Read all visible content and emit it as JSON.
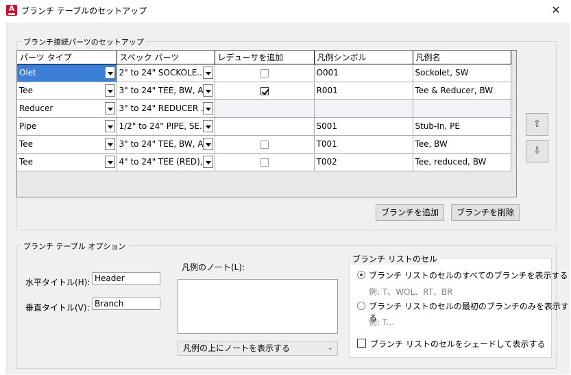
{
  "window": {
    "title": "ブランチ テーブルのセットアップ",
    "close_glyph": "✕",
    "icon_letter": "A"
  },
  "parts_group": {
    "legend": "ブランチ接続パーツのセットアップ",
    "columns": [
      "パーツ タイプ",
      "スペック パーツ",
      "レデューサを追加",
      "凡例シンボル",
      "凡例名"
    ],
    "rows": [
      {
        "part_type": "Olet",
        "spec_part": "2\" to 24\"  SOCKOLE...",
        "add_reducer": "unchecked",
        "symbol": "O001",
        "legend_name": "Sockolet, SW",
        "selected": true
      },
      {
        "part_type": "Tee",
        "spec_part": "3\" to 24\"  TEE, BW, A...",
        "add_reducer": "checked",
        "symbol": "R001",
        "legend_name": "Tee & Reducer, BW"
      },
      {
        "part_type": "Reducer",
        "spec_part": "3\" to 24\"  REDUCER ...",
        "add_reducer": "none",
        "symbol": "",
        "legend_name": "",
        "greyed": true
      },
      {
        "part_type": "Pipe",
        "spec_part": "1/2\" to 24\"  PIPE, SE...",
        "add_reducer": "none",
        "symbol": "S001",
        "legend_name": "Stub-In, PE"
      },
      {
        "part_type": "Tee",
        "spec_part": "3\" to 24\"  TEE, BW, A...",
        "add_reducer": "unchecked",
        "symbol": "T001",
        "legend_name": "Tee, BW"
      },
      {
        "part_type": "Tee",
        "spec_part": "4\" to 24\"  TEE (RED),...",
        "add_reducer": "unchecked",
        "symbol": "T002",
        "legend_name": "Tee, reduced, BW"
      }
    ],
    "move_up_glyph": "⇧",
    "move_down_glyph": "⇩",
    "add_branch_label": "ブランチを追加",
    "delete_branch_label": "ブランチを削除"
  },
  "options_group": {
    "legend": "ブランチ テーブル オプション",
    "horizontal_title_label": "水平タイトル(H):",
    "horizontal_title_value": "Header",
    "vertical_title_label": "垂直タイトル(V):",
    "vertical_title_value": "Branch",
    "legend_note_label": "凡例のノート(L):",
    "legend_note_value": "",
    "note_position_value": "凡例の上にノートを表示する",
    "branch_list_cell": {
      "legend": "ブランチ リストのセル",
      "option_all": "ブランチ リストのセルのすべてのブランチを表示する",
      "option_all_example": "例: T、WOL、RT、BR",
      "option_first": "ブランチ リストのセルの最初のブランチのみを表示する",
      "option_first_example": "例: T...",
      "shade_label": "ブランチ リストのセルをシェードして表示する"
    }
  }
}
